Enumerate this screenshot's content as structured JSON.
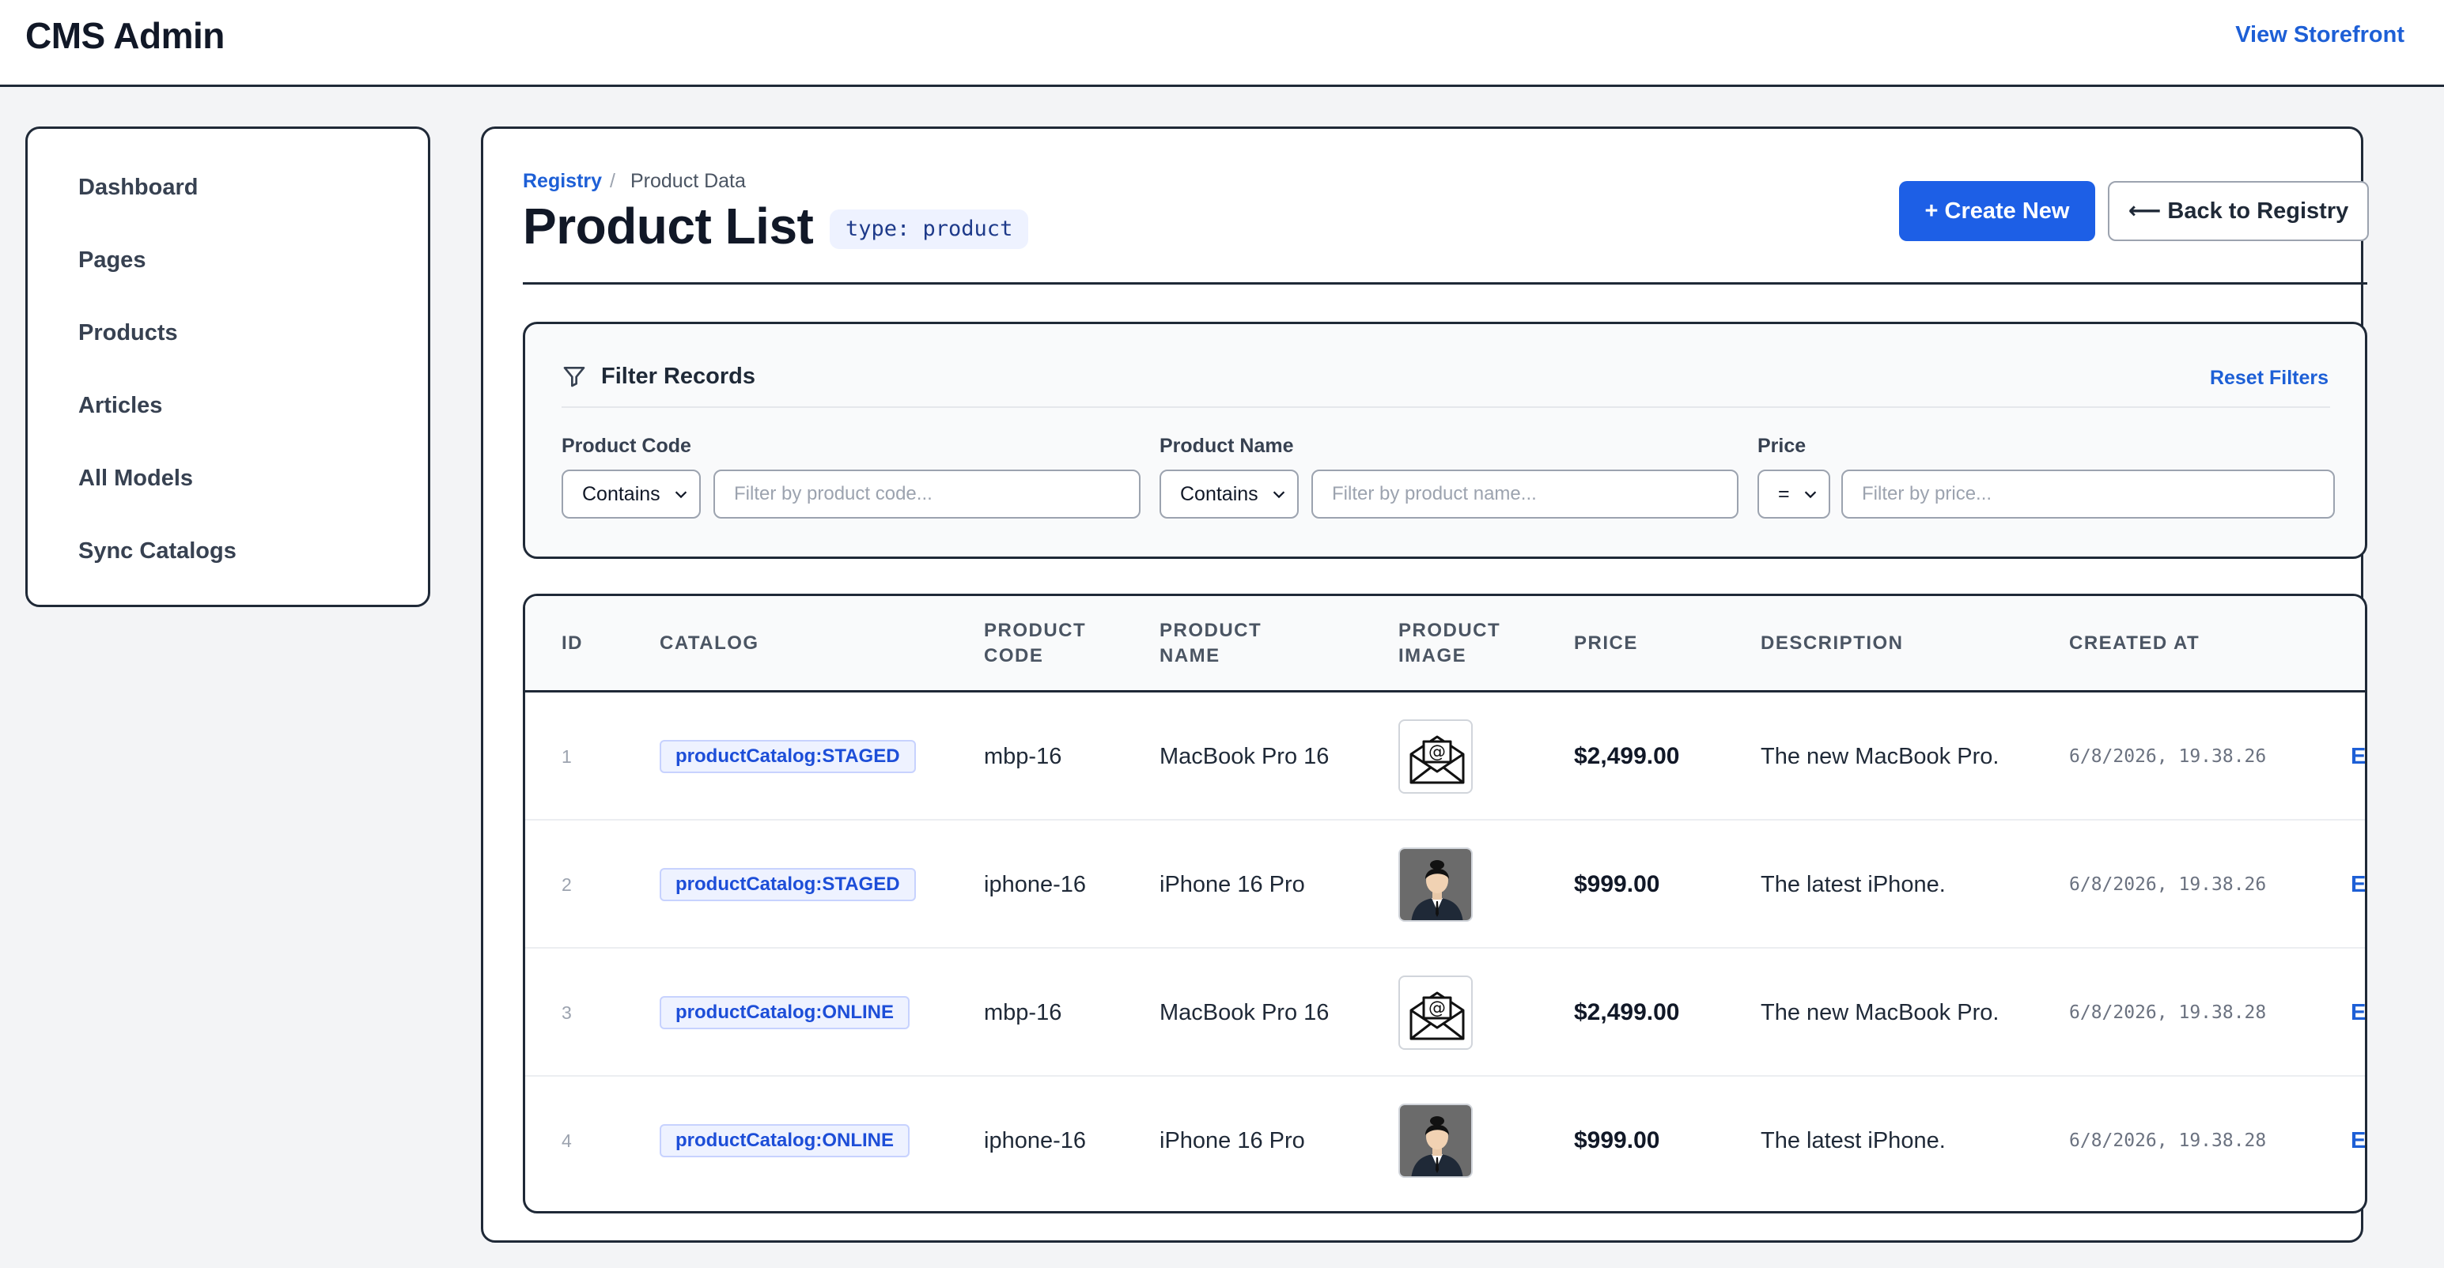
{
  "app": {
    "title": "CMS Admin",
    "storefront_link": "View Storefront"
  },
  "sidebar": {
    "items": [
      {
        "label": "Dashboard"
      },
      {
        "label": "Pages"
      },
      {
        "label": "Products"
      },
      {
        "label": "Articles"
      },
      {
        "label": "All Models"
      },
      {
        "label": "Sync Catalogs"
      }
    ]
  },
  "breadcrumb": {
    "parent": "Registry",
    "separator": "/",
    "current": "Product Data"
  },
  "page": {
    "title": "Product List",
    "type_chip": "type: product",
    "create_button": "+ Create New",
    "back_button": "⟵ Back to Registry"
  },
  "filters": {
    "title": "Filter Records",
    "reset_label": "Reset Filters",
    "fields": [
      {
        "label": "Product Code",
        "operator": "Contains",
        "placeholder": "Filter by product code...",
        "value": ""
      },
      {
        "label": "Product Name",
        "operator": "Contains",
        "placeholder": "Filter by product name...",
        "value": ""
      },
      {
        "label": "Price",
        "operator": "=",
        "placeholder": "Filter by price...",
        "value": ""
      }
    ]
  },
  "table": {
    "columns": [
      "ID",
      "CATALOG",
      "PRODUCT\nCODE",
      "PRODUCT\nNAME",
      "PRODUCT\nIMAGE",
      "PRICE",
      "DESCRIPTION",
      "CREATED AT"
    ],
    "edit_label": "Ed",
    "rows": [
      {
        "id": "1",
        "catalog": "productCatalog:STAGED",
        "code": "mbp-16",
        "name": "MacBook Pro 16",
        "image": "envelope-icon",
        "price": "$2,499.00",
        "description": "The new MacBook Pro.",
        "created": "6/8/2026, 19.38.26"
      },
      {
        "id": "2",
        "catalog": "productCatalog:STAGED",
        "code": "iphone-16",
        "name": "iPhone 16 Pro",
        "image": "person-avatar",
        "price": "$999.00",
        "description": "The latest iPhone.",
        "created": "6/8/2026, 19.38.26"
      },
      {
        "id": "3",
        "catalog": "productCatalog:ONLINE",
        "code": "mbp-16",
        "name": "MacBook Pro 16",
        "image": "envelope-icon",
        "price": "$2,499.00",
        "description": "The new MacBook Pro.",
        "created": "6/8/2026, 19.38.28"
      },
      {
        "id": "4",
        "catalog": "productCatalog:ONLINE",
        "code": "iphone-16",
        "name": "iPhone 16 Pro",
        "image": "person-avatar",
        "price": "$999.00",
        "description": "The latest iPhone.",
        "created": "6/8/2026, 19.38.28"
      }
    ]
  },
  "colors": {
    "accent": "#1d5fe6",
    "link": "#1d5fd6",
    "border": "#1f2937",
    "background": "#f3f4f6"
  }
}
